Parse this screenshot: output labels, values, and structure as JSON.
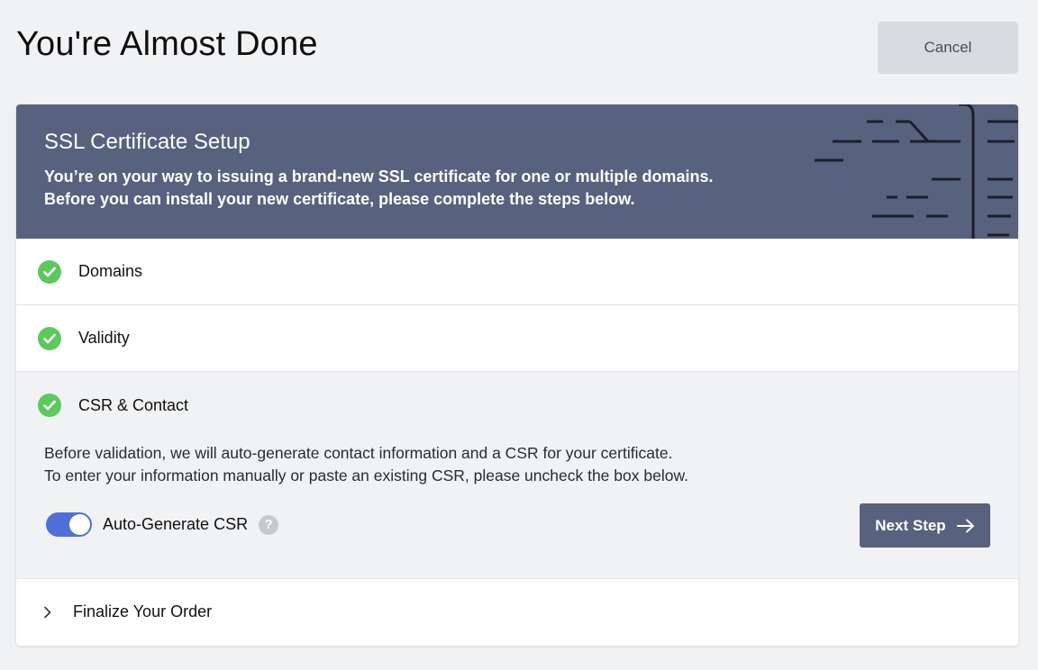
{
  "page": {
    "title": "You're Almost Done"
  },
  "header": {
    "cancel_label": "Cancel"
  },
  "banner": {
    "title": "SSL Certificate Setup",
    "line1": "You’re on your way to issuing a brand-new SSL certificate for one or multiple domains.",
    "line2": "Before you can install your new certificate, please complete the steps below."
  },
  "steps": [
    {
      "label": "Domains",
      "status": "complete",
      "icon": "check-circle-icon"
    },
    {
      "label": "Validity",
      "status": "complete",
      "icon": "check-circle-icon"
    },
    {
      "label": "CSR & Contact",
      "status": "complete",
      "icon": "check-circle-icon"
    },
    {
      "label": "Finalize Your Order",
      "status": "collapsed",
      "icon": "chevron-right-icon"
    }
  ],
  "csr": {
    "desc_line1": "Before validation, we will auto-generate contact information and a CSR for your certificate.",
    "desc_line2": "To enter your information manually or paste an existing CSR, please uncheck the box below.",
    "toggle_label": "Auto-Generate CSR",
    "toggle_on": true,
    "help_glyph": "?",
    "next_label": "Next Step"
  },
  "colors": {
    "banner": "#58627e",
    "check": "#5cc95c",
    "toggle": "#4f6fd9",
    "cancel_bg": "#d9dbe0"
  }
}
